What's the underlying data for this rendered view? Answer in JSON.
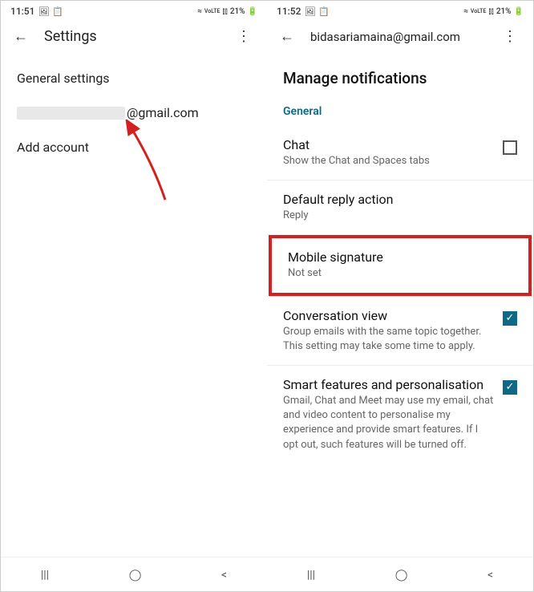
{
  "left": {
    "status": {
      "time": "11:51",
      "battery": "21%",
      "network": "VoLTE"
    },
    "app_title": "Settings",
    "items": {
      "general": "General settings",
      "email_suffix": "@gmail.com",
      "add_account": "Add account"
    }
  },
  "right": {
    "status": {
      "time": "11:52",
      "battery": "21%",
      "network": "VoLTE"
    },
    "app_title": "bidasariamaina@gmail.com",
    "heading": "Manage notifications",
    "subheading": "General",
    "settings": {
      "chat": {
        "title": "Chat",
        "sub": "Show the Chat and Spaces tabs"
      },
      "reply": {
        "title": "Default reply action",
        "sub": "Reply"
      },
      "signature": {
        "title": "Mobile signature",
        "sub": "Not set"
      },
      "conversation": {
        "title": "Conversation view",
        "sub": "Group emails with the same topic together. This setting may take some time to apply."
      },
      "smart": {
        "title": "Smart features and personalisation",
        "sub": "Gmail, Chat and Meet may use my email, chat and video content to personalise my experience and provide smart features. If I opt out, such features will be turned off."
      }
    }
  },
  "icons": {
    "image": "🖼",
    "clipboard": "📋",
    "wifi": "≈",
    "signal": "⫾⫾",
    "battery": "🔋",
    "back": "←",
    "more": "⋮",
    "recents": "|||",
    "home": "◯",
    "nav_back": "<",
    "check": "✓"
  }
}
